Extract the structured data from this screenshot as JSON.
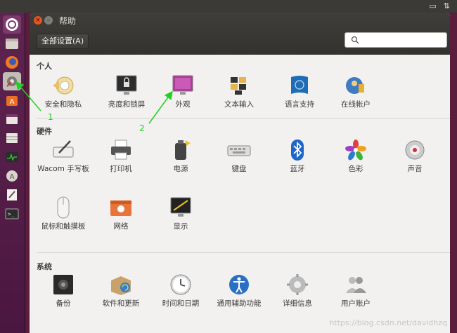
{
  "window": {
    "title": "帮助",
    "all_settings_label": "全部设置(A)",
    "search_placeholder": ""
  },
  "sections": {
    "personal": "个人",
    "hardware": "硬件",
    "system": "系统"
  },
  "personal_items": [
    {
      "label": "安全和隐私",
      "icon": "security-privacy-icon"
    },
    {
      "label": "亮度和锁屏",
      "icon": "brightness-lock-icon"
    },
    {
      "label": "外观",
      "icon": "appearance-icon"
    },
    {
      "label": "文本输入",
      "icon": "text-input-icon"
    },
    {
      "label": "语言支持",
      "icon": "language-support-icon"
    },
    {
      "label": "在线帐户",
      "icon": "online-accounts-icon"
    }
  ],
  "hardware_items": [
    {
      "label": "Wacom 手写板",
      "icon": "wacom-tablet-icon"
    },
    {
      "label": "打印机",
      "icon": "printer-icon"
    },
    {
      "label": "电源",
      "icon": "power-icon"
    },
    {
      "label": "键盘",
      "icon": "keyboard-icon"
    },
    {
      "label": "蓝牙",
      "icon": "bluetooth-icon"
    },
    {
      "label": "色彩",
      "icon": "color-icon"
    },
    {
      "label": "声音",
      "icon": "sound-icon"
    },
    {
      "label": "鼠标和触摸板",
      "icon": "mouse-touchpad-icon"
    },
    {
      "label": "网络",
      "icon": "network-icon"
    },
    {
      "label": "显示",
      "icon": "display-icon"
    }
  ],
  "system_items": [
    {
      "label": "备份",
      "icon": "backup-icon"
    },
    {
      "label": "软件和更新",
      "icon": "software-updates-icon"
    },
    {
      "label": "时间和日期",
      "icon": "time-date-icon"
    },
    {
      "label": "通用辅助功能",
      "icon": "universal-access-icon"
    },
    {
      "label": "详细信息",
      "icon": "details-icon"
    },
    {
      "label": "用户账户",
      "icon": "user-accounts-icon"
    }
  ],
  "annotations": {
    "one": "1",
    "two": "2"
  },
  "watermark": "https://blog.csdn.net/davidhzq",
  "colors": {
    "launcher": "#5e2450",
    "titlebar": "#3f3e3a",
    "window_bg": "#f2f1f0",
    "close_button": "#e9541f",
    "annotation_green": "#22d022"
  }
}
